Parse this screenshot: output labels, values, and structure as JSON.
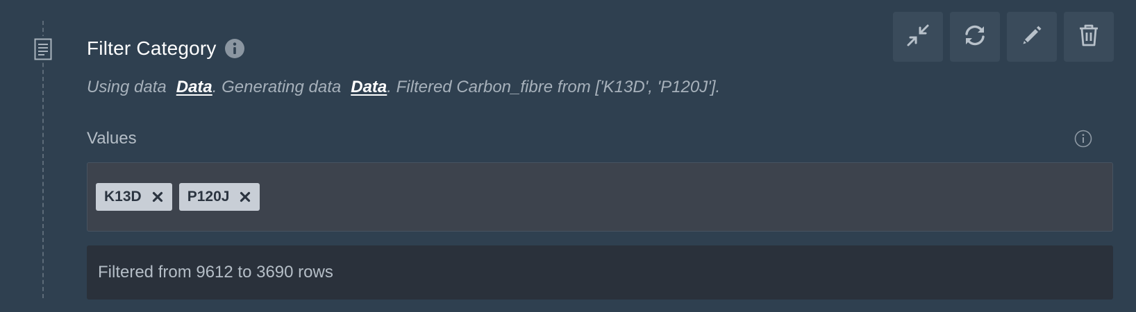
{
  "step": {
    "title": "Filter Category",
    "icon": "document-icon",
    "description": {
      "prefix": "Using data",
      "input_link": "Data",
      "middle": ". Generating data",
      "output_link": "Data",
      "suffix": ". Filtered Carbon_fibre from ['K13D', 'P120J']."
    }
  },
  "toolbar": {
    "buttons": [
      {
        "name": "collapse",
        "icon": "collapse-icon"
      },
      {
        "name": "refresh",
        "icon": "refresh-icon"
      },
      {
        "name": "edit",
        "icon": "pencil-icon"
      },
      {
        "name": "delete",
        "icon": "trash-icon"
      }
    ]
  },
  "values": {
    "label": "Values",
    "tags": [
      {
        "label": "K13D"
      },
      {
        "label": "P120J"
      }
    ]
  },
  "result": {
    "text": "Filtered from 9612 to 3690 rows"
  },
  "colors": {
    "background": "#2f4050",
    "button_bg": "#3a4b5b",
    "tag_bg": "#c8ced6",
    "link": "#ffffff"
  }
}
